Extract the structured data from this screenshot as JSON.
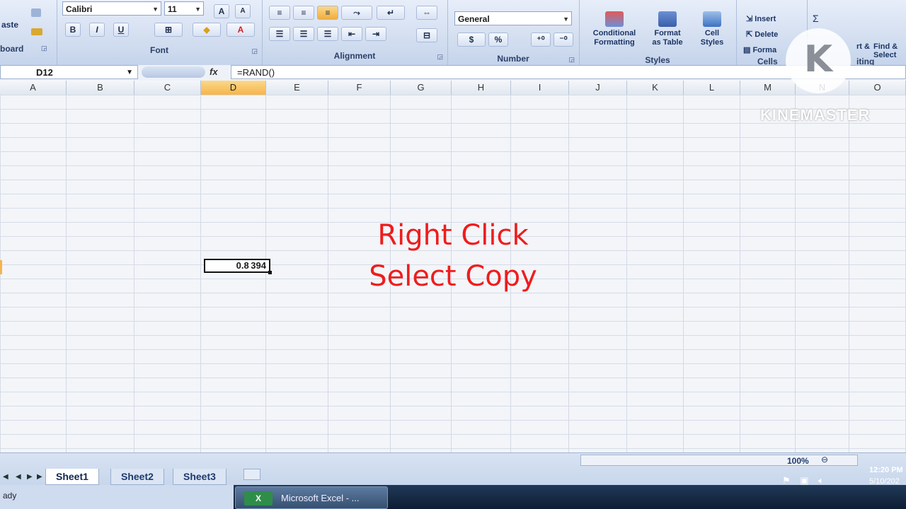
{
  "ribbon": {
    "clipboard": {
      "paste_label": "aste",
      "group_label": "board"
    },
    "font": {
      "group_label": "Font",
      "font_name": "Calibri",
      "font_size": "11",
      "grow_label": "A",
      "shrink_label": "A",
      "bold_label": "B",
      "italic_label": "I",
      "underline_label": "U",
      "font_color_label": "A"
    },
    "alignment": {
      "group_label": "Alignment"
    },
    "number": {
      "group_label": "Number",
      "format": "General",
      "currency_label": "$",
      "percent_label": "%"
    },
    "styles": {
      "group_label": "Styles",
      "conditional": [
        "Conditional",
        "Formatting"
      ],
      "format_table": [
        "Format",
        "as Table"
      ],
      "cell_styles": [
        "Cell",
        "Styles"
      ]
    },
    "cells": {
      "group_label": "Cells",
      "insert_label": "Insert",
      "delete_label": "Delete",
      "format_label": "Forma"
    },
    "editing": {
      "sort_label": "rt &",
      "find_label": "Find &",
      "select_label": "Select",
      "group_label": "iting"
    }
  },
  "formula_bar": {
    "name_box": "D12",
    "fx_label": "fx",
    "formula": "=RAND()"
  },
  "columns": [
    "A",
    "B",
    "C",
    "D",
    "E",
    "F",
    "G",
    "H",
    "I",
    "J",
    "K",
    "L",
    "M",
    "N",
    "O"
  ],
  "active_column": "D",
  "active_cell_value": "0.8 394",
  "overlay": {
    "line1": "Right Click",
    "line2": "Select Copy"
  },
  "watermark": {
    "letter": "K",
    "text": "KINEMASTER"
  },
  "sheets": [
    "Sheet1",
    "Sheet2",
    "Sheet3"
  ],
  "active_sheet": "Sheet1",
  "status_text": "ady",
  "zoom": "100%",
  "taskbar": {
    "app_label": "Microsoft Excel - ...",
    "app_icon": "X",
    "time": "12:20 PM",
    "date": "5/10/202"
  }
}
